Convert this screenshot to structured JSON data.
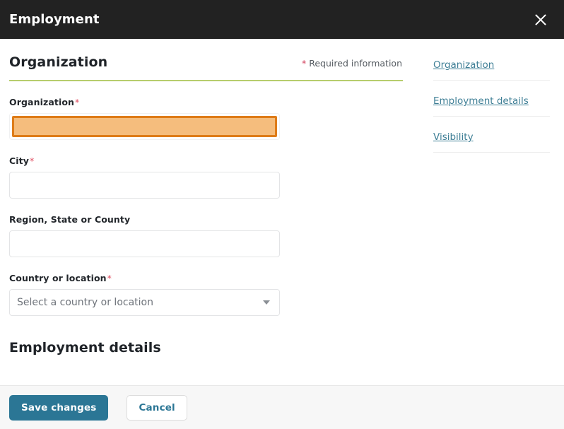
{
  "header": {
    "title": "Employment",
    "close_icon": "close-icon"
  },
  "form": {
    "section_title": "Organization",
    "required_note_star": "*",
    "required_note_text": " Required information",
    "fields": [
      {
        "label": "Organization",
        "required_mark": "*",
        "value": "",
        "state": "highlighted"
      },
      {
        "label": "City",
        "required_mark": "*",
        "value": "",
        "state": "normal"
      },
      {
        "label": "Region, State or County",
        "required_mark": "",
        "value": "",
        "state": "normal"
      },
      {
        "label": "Country or location",
        "required_mark": "*",
        "placeholder": "Select a country or location",
        "state": "select"
      }
    ],
    "next_section_title": "Employment details"
  },
  "side_nav": {
    "items": [
      {
        "label": "Organization"
      },
      {
        "label": "Employment details"
      },
      {
        "label": "Visibility"
      }
    ]
  },
  "footer": {
    "save_label": "Save changes",
    "cancel_label": "Cancel"
  },
  "colors": {
    "header_bg": "#222222",
    "accent_teal": "#2b7695",
    "rule_green": "#b7cd6d",
    "highlight_border": "#de7c18",
    "highlight_fill": "#f5bd7d",
    "required_star": "#e04b5f"
  },
  "scrollbar": {
    "up_icon": "chevron-up-icon",
    "down_icon": "chevron-down-icon"
  }
}
